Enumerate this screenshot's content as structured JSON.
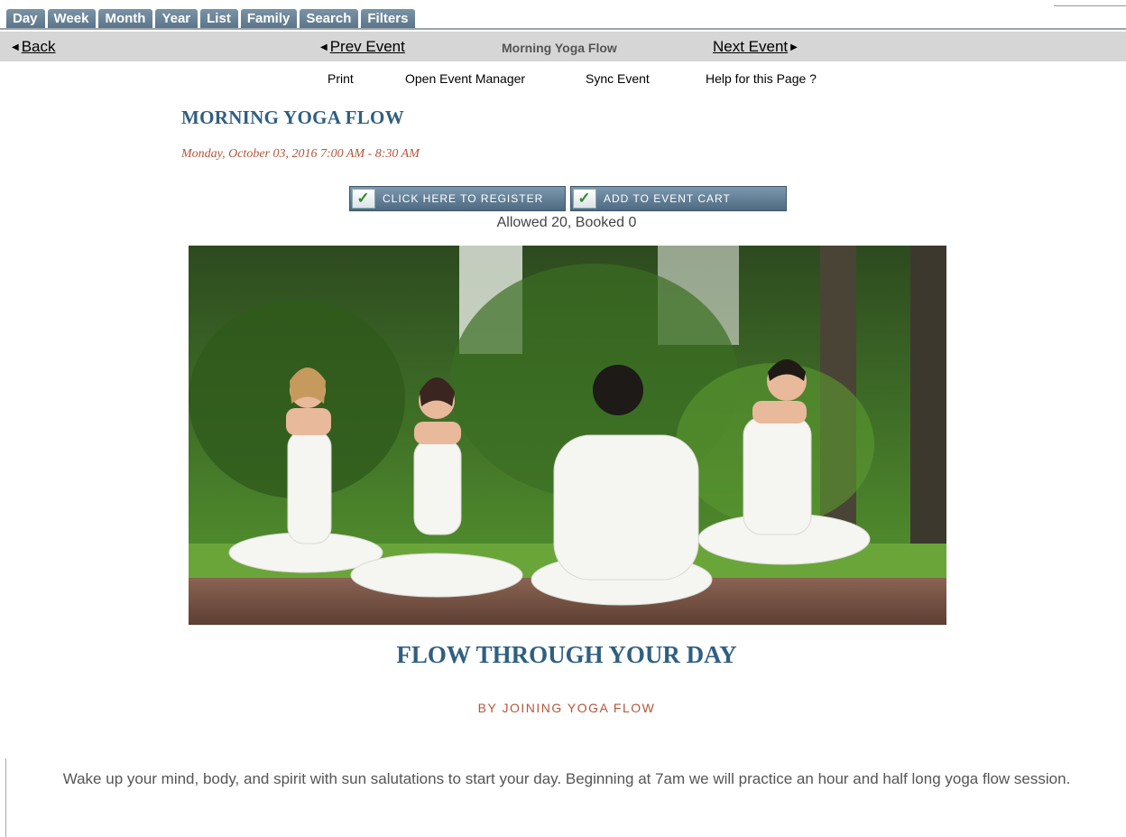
{
  "tabs": [
    "Day",
    "Week",
    "Month",
    "Year",
    "List",
    "Family",
    "Search",
    "Filters"
  ],
  "nav": {
    "back": "Back",
    "prev": "Prev Event",
    "current": "Morning Yoga Flow",
    "next": "Next Event"
  },
  "actions": {
    "print": "Print",
    "open_manager": "Open Event Manager",
    "sync": "Sync Event",
    "help": "Help for this Page ?"
  },
  "event": {
    "title": "MORNING YOGA FLOW",
    "datetime": "Monday, October 03, 2016 7:00 AM - 8:30 AM",
    "register_label": "CLICK HERE TO REGISTER",
    "cart_label": "ADD TO EVENT CART",
    "capacity": "Allowed 20, Booked 0"
  },
  "content": {
    "heading": "FLOW THROUGH YOUR DAY",
    "subheading": "BY JOINING YOGA FLOW",
    "description": "Wake up your mind, body, and spirit with sun salutations to start your day. Beginning at 7am we will practice an hour and half long yoga flow session."
  },
  "colors": {
    "tab": "#6c859a",
    "title": "#2f5f81",
    "accent": "#b4553a",
    "navbar": "#d6d6d6"
  }
}
